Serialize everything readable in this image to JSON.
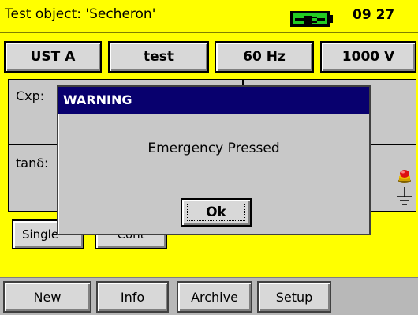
{
  "header": {
    "title": "Test object: 'Secheron'",
    "clock": "09 27",
    "battery_color": "#22cc22"
  },
  "top_buttons": [
    "UST A",
    "test",
    "60 Hz",
    "1000 V"
  ],
  "panels": {
    "cxp_label": "Cxp:",
    "tan_label": "tanδ:"
  },
  "mode_buttons": [
    "Single",
    "Cont"
  ],
  "dialog": {
    "title": "WARNING",
    "message": "Emergency Pressed",
    "ok_label": "Ok",
    "title_color": "#08006e"
  },
  "bottom_buttons": [
    "New",
    "Info",
    "Archive",
    "Setup"
  ],
  "icons": {
    "emergency": "emergency-stop-icon",
    "earth": "ground-icon"
  }
}
